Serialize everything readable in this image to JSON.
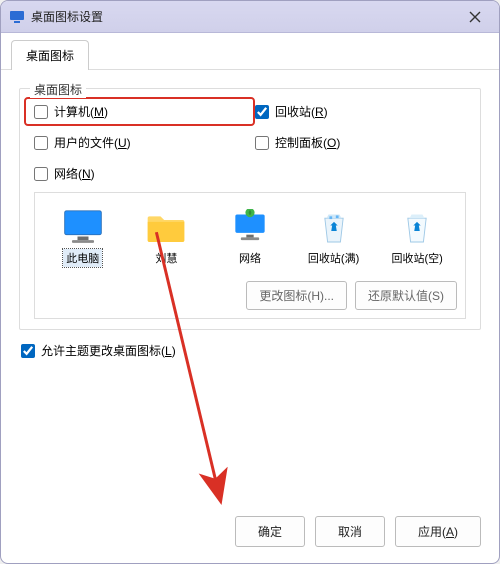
{
  "titlebar": {
    "title": "桌面图标设置"
  },
  "tabs": {
    "active": "桌面图标"
  },
  "group": {
    "title": "桌面图标",
    "computer": {
      "label": "计算机(",
      "key": "M",
      "suffix": ")",
      "checked": false
    },
    "recycle": {
      "label": "回收站(",
      "key": "R",
      "suffix": ")",
      "checked": true
    },
    "userfiles": {
      "label": "用户的文件(",
      "key": "U",
      "suffix": ")",
      "checked": false
    },
    "cpanel": {
      "label": "控制面板(",
      "key": "O",
      "suffix": ")",
      "checked": false
    },
    "network": {
      "label": "网络(",
      "key": "N",
      "suffix": ")",
      "checked": false
    }
  },
  "icons": {
    "this_pc": "此电脑",
    "user_folder": "刘慧",
    "network": "网络",
    "recycle_full": "回收站(满)",
    "recycle_empty": "回收站(空)"
  },
  "panel_buttons": {
    "change_icon": "更改图标(H)...",
    "restore_default": "还原默认值(S)"
  },
  "allow_themes": {
    "label": "允许主题更改桌面图标(",
    "key": "L",
    "suffix": ")",
    "checked": true
  },
  "footer": {
    "ok": "确定",
    "cancel": "取消",
    "apply": "应用(",
    "apply_key": "A",
    "apply_suffix": ")"
  }
}
